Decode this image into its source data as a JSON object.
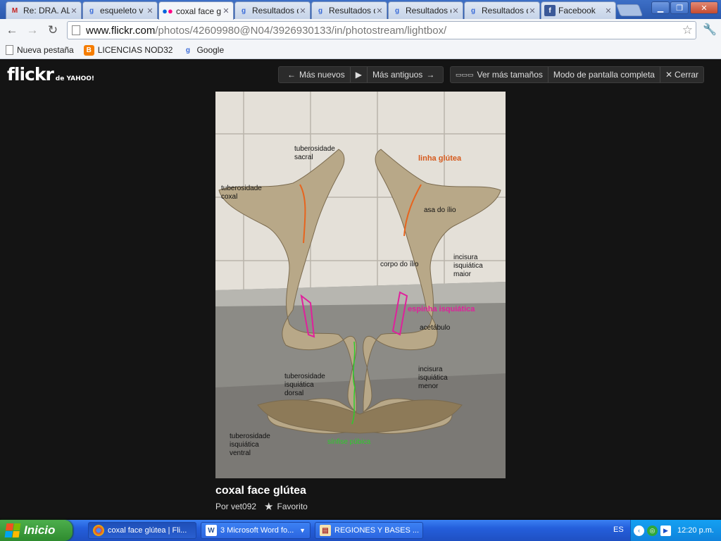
{
  "tabs": [
    {
      "label": "Re: DRA. AL",
      "icon": "gmail-icon",
      "active": false
    },
    {
      "label": "esqueleto v",
      "icon": "google-icon",
      "active": false
    },
    {
      "label": "coxal face g",
      "icon": "flickr-icon",
      "active": true
    },
    {
      "label": "Resultados d",
      "icon": "google-icon",
      "active": false
    },
    {
      "label": "Resultados d",
      "icon": "google-icon",
      "active": false
    },
    {
      "label": "Resultados d",
      "icon": "google-icon",
      "active": false
    },
    {
      "label": "Resultados d",
      "icon": "google-icon",
      "active": false
    },
    {
      "label": "Facebook",
      "icon": "facebook-icon",
      "active": false
    }
  ],
  "address": {
    "host": "www.flickr.com",
    "path": "/photos/42609980@N04/3926930133/in/photostream/lightbox/"
  },
  "bookmarks": [
    {
      "label": "Nueva pestaña",
      "icon": "page-icon"
    },
    {
      "label": "LICENCIAS NOD32",
      "icon": "blogger-icon"
    },
    {
      "label": "Google",
      "icon": "google-icon"
    }
  ],
  "flickr": {
    "logo": "flickr",
    "logo_suffix": "de YAHOO!",
    "nav": {
      "newer": "Más nuevos",
      "older": "Más antiguos",
      "sizes": "Ver más tamaños",
      "fullscreen": "Modo de pantalla completa",
      "close": "Cerrar"
    },
    "photo": {
      "title": "coxal face glútea",
      "author": "Por vet092",
      "favorite": "Favorito",
      "annotations": {
        "tuberosidade_sacral": "tuberosidade\nsacral",
        "linha_glutea": "linha glútea",
        "tuberosidade_coxal": "tuberosidade\ncoxal",
        "asa_do_ilio": "asa do ílio",
        "corpo_do_ilio": "corpo do ílio",
        "incisura_maior": "incisura\nisquiática\nmaior",
        "espinha": "espinha isquiática",
        "acetabulo": "acetábulo",
        "tuberosidade_dorsal": "tuberosidade\nisquiática\ndorsal",
        "incisura_menor": "incisura\nisquiática\nmenor",
        "tuberosidade_ventral": "tuberosidade\nisquiática\nventral",
        "sinfise": "sínfise púbica"
      }
    }
  },
  "taskbar": {
    "start": "Inicio",
    "items": [
      {
        "label": "coxal face glútea | Fli...",
        "icon": "chrome-icon",
        "active": true,
        "dropdown": false
      },
      {
        "label": "3 Microsoft Word fo...",
        "icon": "word-icon",
        "active": false,
        "dropdown": true
      },
      {
        "label": "REGIONES Y BASES ...",
        "icon": "document-icon",
        "active": false,
        "dropdown": false
      }
    ],
    "lang": "ES",
    "clock": "12:20 p.m."
  }
}
